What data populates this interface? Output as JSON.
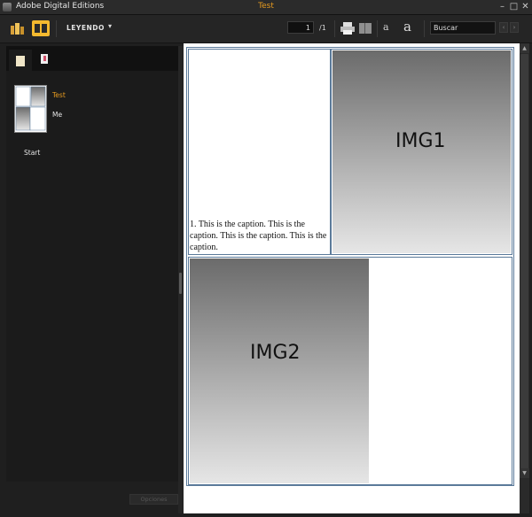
{
  "window": {
    "app_title": "Adobe Digital Editions",
    "document_title": "Test",
    "controls": {
      "minimize": "–",
      "maximize": "□",
      "close": "✕"
    }
  },
  "toolbar": {
    "library_icon": "library-books-icon",
    "reading_icon": "reading-view-icon",
    "mode_label": "LEYENDO",
    "mode_caret": "▾",
    "page_current": "1",
    "page_total": "/1",
    "print_icon": "printer-icon",
    "fit_icon": "fit-page-icon",
    "font_decrease_label": "a",
    "font_increase_label": "a",
    "search_placeholder": "Buscar",
    "search_prev": "‹",
    "search_next": "›"
  },
  "sidebar": {
    "tabs": [
      {
        "icon": "page-thumbnail-icon"
      },
      {
        "icon": "bookmark-icon"
      }
    ],
    "toc": {
      "item1": "Test",
      "item2": "Me",
      "item3": "Start"
    },
    "bottom_button": "Opciones"
  },
  "document": {
    "img1_label": "IMG1",
    "img2_label": "IMG2",
    "caption": "1. This is the caption. This is the caption. This is the caption. This is the caption."
  },
  "colors": {
    "accent": "#e79b1f",
    "table_border": "#5b7a9a",
    "chrome": "#1f1f1f"
  }
}
